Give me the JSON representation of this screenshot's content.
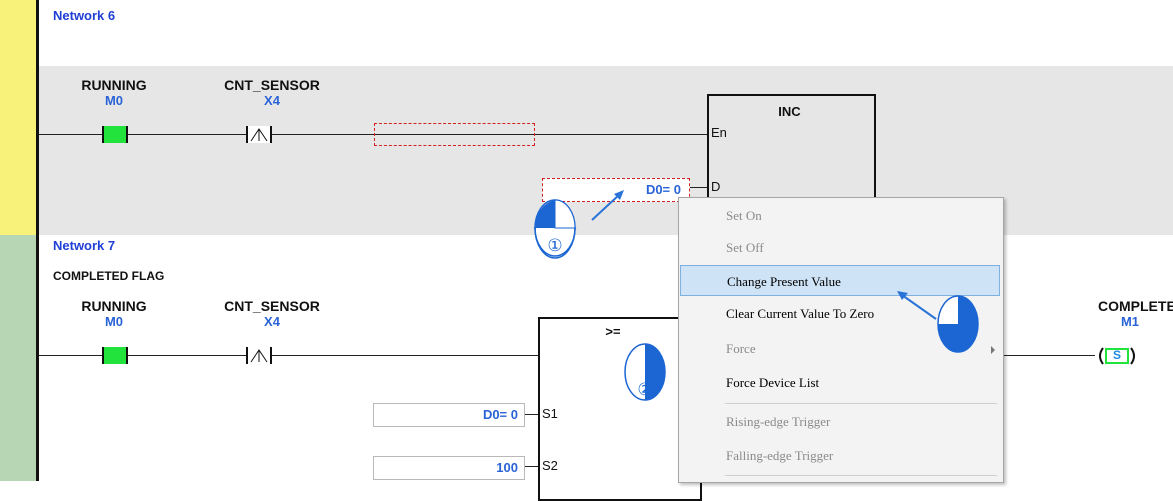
{
  "networks": [
    {
      "title": "Network 6",
      "comment": ""
    },
    {
      "title": "Network 7",
      "comment": "COMPLETED FLAG"
    }
  ],
  "rung6": {
    "contacts": [
      {
        "name": "RUNNING",
        "address": "M0",
        "type": "normally-open-on"
      },
      {
        "name": "CNT_SENSOR",
        "address": "X4",
        "type": "rising-edge"
      }
    ],
    "function": {
      "name": "INC",
      "pins": [
        "En",
        "D"
      ]
    },
    "d_value": "D0= 0"
  },
  "rung7": {
    "contacts": [
      {
        "name": "RUNNING",
        "address": "M0",
        "type": "normally-open-on"
      },
      {
        "name": "CNT_SENSOR",
        "address": "X4",
        "type": "rising-edge"
      }
    ],
    "function": {
      "name": ">=",
      "pins": [
        "S1",
        "S2"
      ]
    },
    "s1_value": "D0= 0",
    "s2_value": "100",
    "coil": {
      "name": "COMPLETE",
      "address": "M1",
      "symbol": "S"
    }
  },
  "context_menu": {
    "items": [
      {
        "label": "Set On",
        "enabled": false
      },
      {
        "label": "Set Off",
        "enabled": false
      },
      {
        "label": "Change Present Value",
        "enabled": true,
        "highlighted": true
      },
      {
        "label": "Clear Current Value To Zero",
        "enabled": true
      },
      {
        "label": "Force",
        "enabled": false,
        "submenu": true
      },
      {
        "label": "Force Device List",
        "enabled": true
      },
      {
        "label": "Rising-edge Trigger",
        "enabled": false
      },
      {
        "label": "Falling-edge Trigger",
        "enabled": false
      }
    ]
  },
  "callouts": [
    "①",
    "②",
    "③"
  ],
  "colors": {
    "network6_gutter": "#f8f17a",
    "network7_gutter": "#b7d7b4",
    "contact_on": "#22e33b",
    "network_title": "#1f3fd6",
    "device_address": "#2a63d8",
    "menu_highlight": "#cfe3f6",
    "callout_blue": "#1b66d2"
  }
}
